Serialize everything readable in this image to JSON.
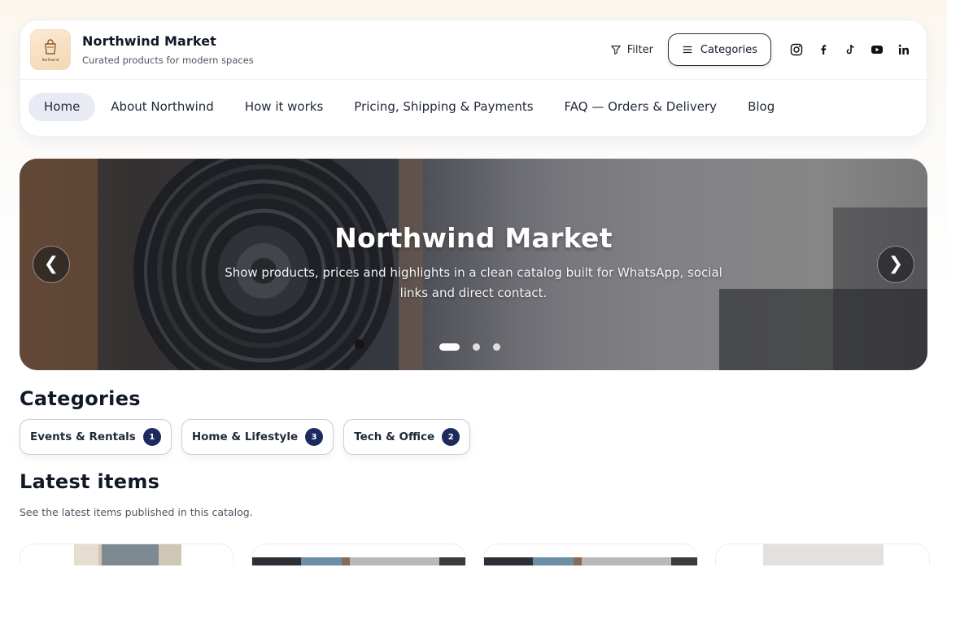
{
  "brand": {
    "name": "Northwind Market",
    "tagline": "Curated products for modern spaces",
    "logo_text": "Northwind"
  },
  "header_actions": {
    "filter_label": "Filter",
    "categories_label": "Categories",
    "socials": [
      "instagram-icon",
      "facebook-icon",
      "tiktok-icon",
      "youtube-icon",
      "linkedin-icon"
    ]
  },
  "nav": [
    {
      "label": "Home",
      "active": true
    },
    {
      "label": "About Northwind"
    },
    {
      "label": "How it works"
    },
    {
      "label": "Pricing, Shipping & Payments"
    },
    {
      "label": "FAQ — Orders & Delivery"
    },
    {
      "label": "Blog"
    }
  ],
  "hero": {
    "title": "Northwind Market",
    "description": "Show products, prices and highlights in a clean catalog built for WhatsApp, social links and direct contact.",
    "prev_arrow": "❮",
    "next_arrow": "❯",
    "slide_count": 3,
    "active_slide": 1
  },
  "categories": {
    "title": "Categories",
    "items": [
      {
        "label": "Events & Rentals",
        "count": "1"
      },
      {
        "label": "Home & Lifestyle",
        "count": "3"
      },
      {
        "label": "Tech & Office",
        "count": "2"
      }
    ]
  },
  "latest": {
    "title": "Latest items",
    "subtitle": "See the latest items published in this catalog."
  },
  "colors": {
    "accent": "#1e2a5e",
    "nav_active_bg": "#e8ebf4"
  }
}
